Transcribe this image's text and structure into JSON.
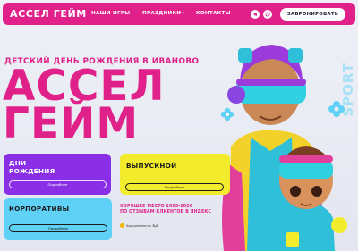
{
  "nav": {
    "logo": "АССЕЛ ГЕЙМ",
    "links": [
      {
        "label": "НАШИ ИГРЫ"
      },
      {
        "label": "ПРАЗДНИКИ"
      },
      {
        "label": "КОНТАКТЫ"
      }
    ],
    "book_label": "ЗАБРОНИРОВАТЬ"
  },
  "hero": {
    "subtitle": "ДЕТСКИЙ ДЕНЬ РОЖДЕНИЯ В ИВАНОВО",
    "title_line1": "АССЕЛ",
    "title_line2": "ГЕЙМ",
    "side_text": "SPORT"
  },
  "cards": {
    "birthday": {
      "title_line1": "ДНИ",
      "title_line2": "РОЖДЕНИЯ",
      "button": "Подробнее"
    },
    "graduation": {
      "title": "ВЫПУСКНОЙ",
      "button": "Подробнее"
    },
    "corporate": {
      "title": "КОРПОРАТИВЫ",
      "button": "Подробнее"
    }
  },
  "rating": {
    "line1": "ХОРОШЕЕ МЕСТО 2025-2026",
    "line2": "ПО ОТЗЫВАМ КЛИЕНТОВ В ЯНДЕКС",
    "badge_label": "Хорошее место",
    "score": "5,0"
  },
  "colors": {
    "brand_pink": "#e0218a",
    "purple": "#8b2fe6",
    "yellow": "#f3ec2c",
    "cyan": "#5fd1f6"
  },
  "icons": [
    "telegram-icon",
    "whatsapp-icon",
    "chevron-down-icon",
    "flower-icon"
  ]
}
